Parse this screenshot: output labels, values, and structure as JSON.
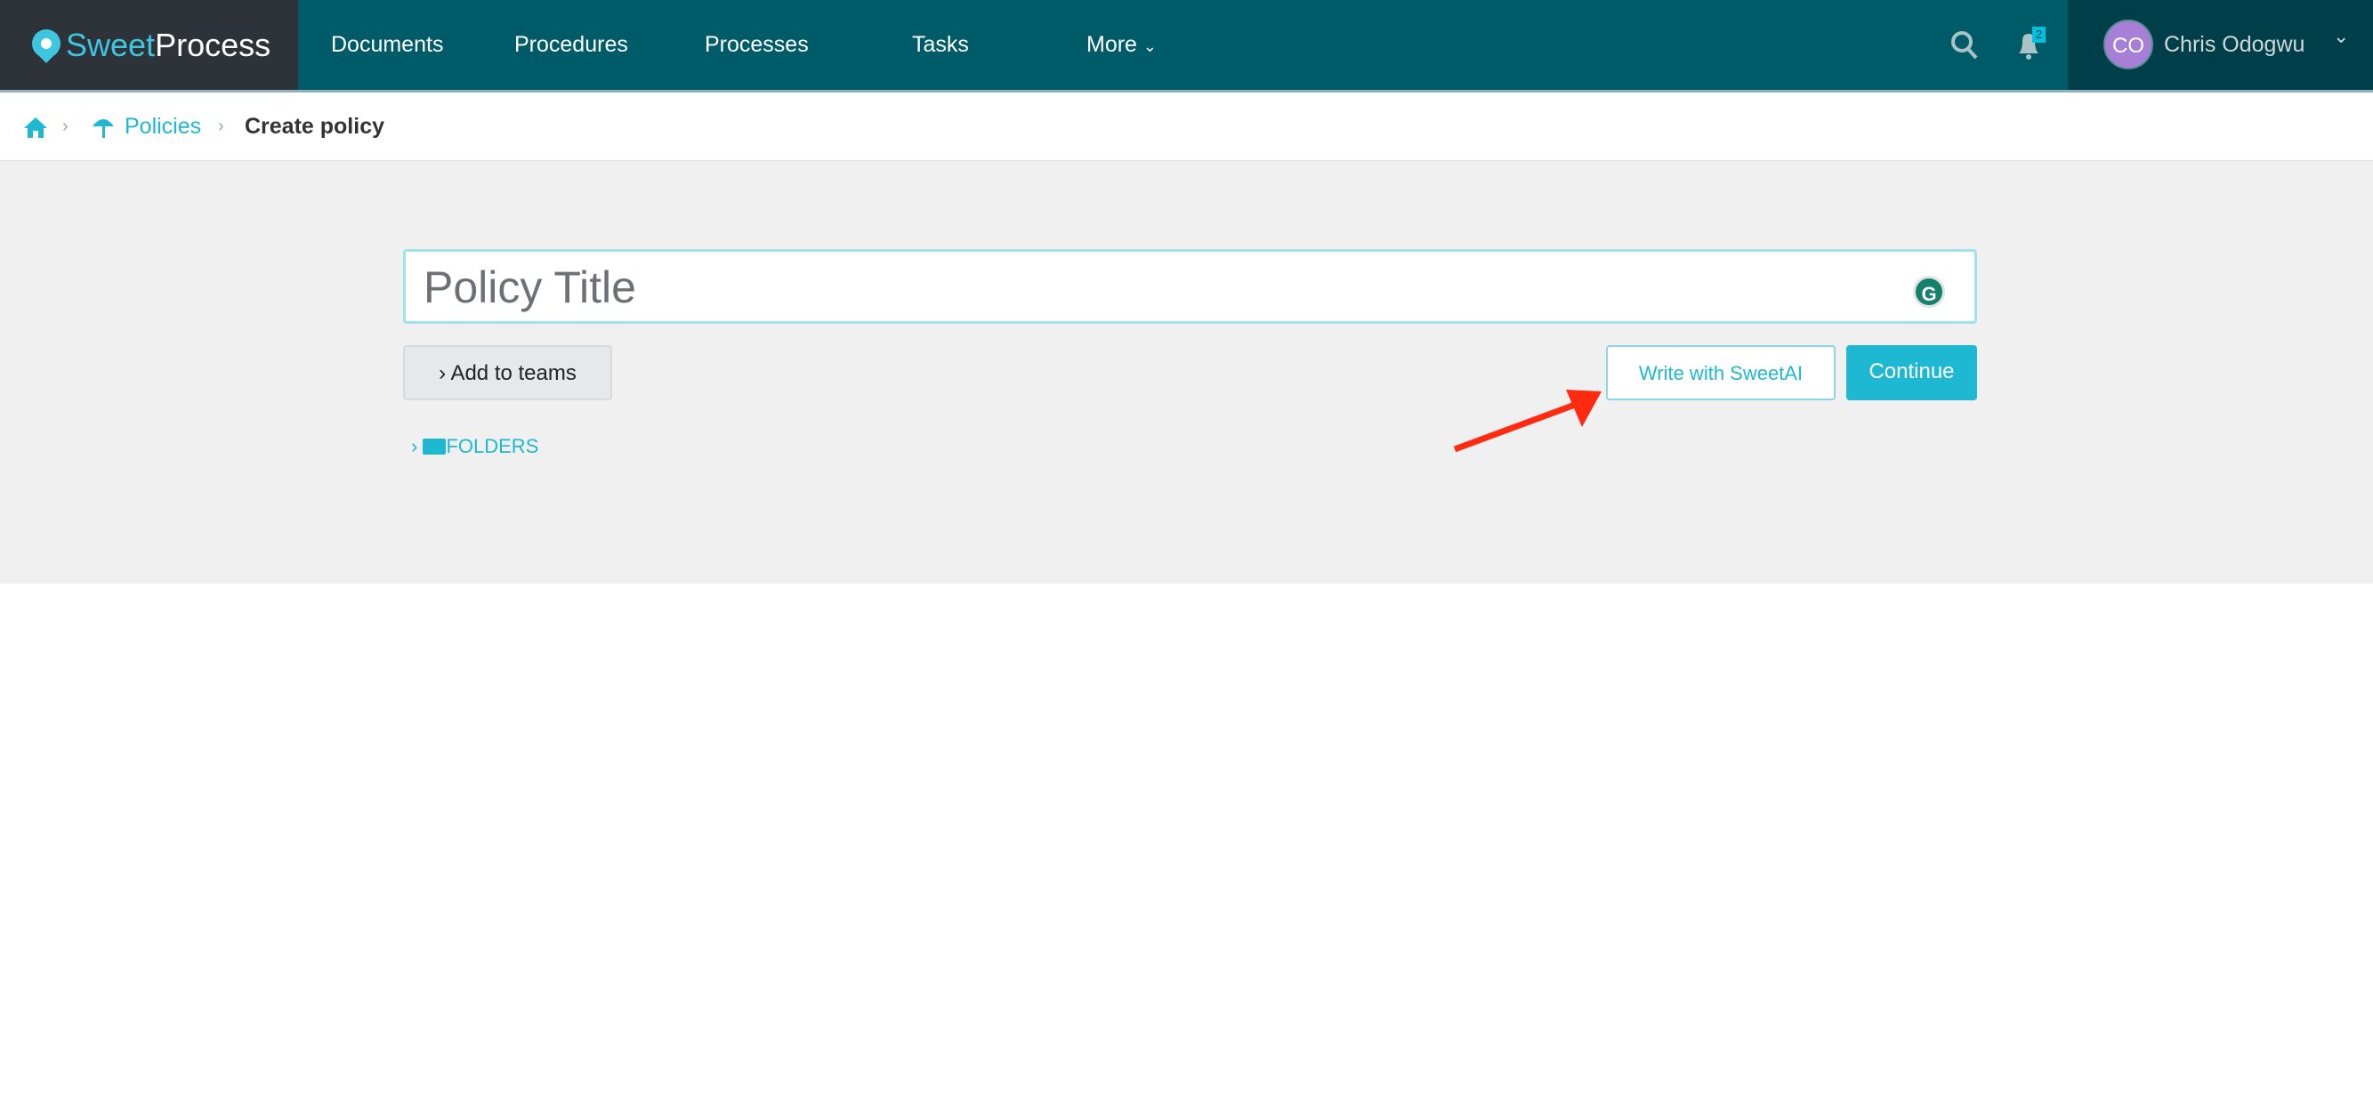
{
  "header": {
    "logo_sweet": "Sweet",
    "logo_process": "Process",
    "nav": [
      "Documents",
      "Procedures",
      "Processes",
      "Tasks",
      "More"
    ],
    "notification_count": "2",
    "user_initials": "CO",
    "user_name": "Chris Odogwu"
  },
  "breadcrumb": {
    "policies": "Policies",
    "current": "Create policy"
  },
  "form": {
    "title_placeholder": "Policy Title",
    "add_to_teams": "Add to teams",
    "write_ai": "Write with SweetAI",
    "continue": "Continue",
    "folders": "FOLDERS"
  },
  "colors": {
    "nav": "#005b69",
    "accent": "#1fb8d3",
    "arrow": "#ff2a10"
  }
}
